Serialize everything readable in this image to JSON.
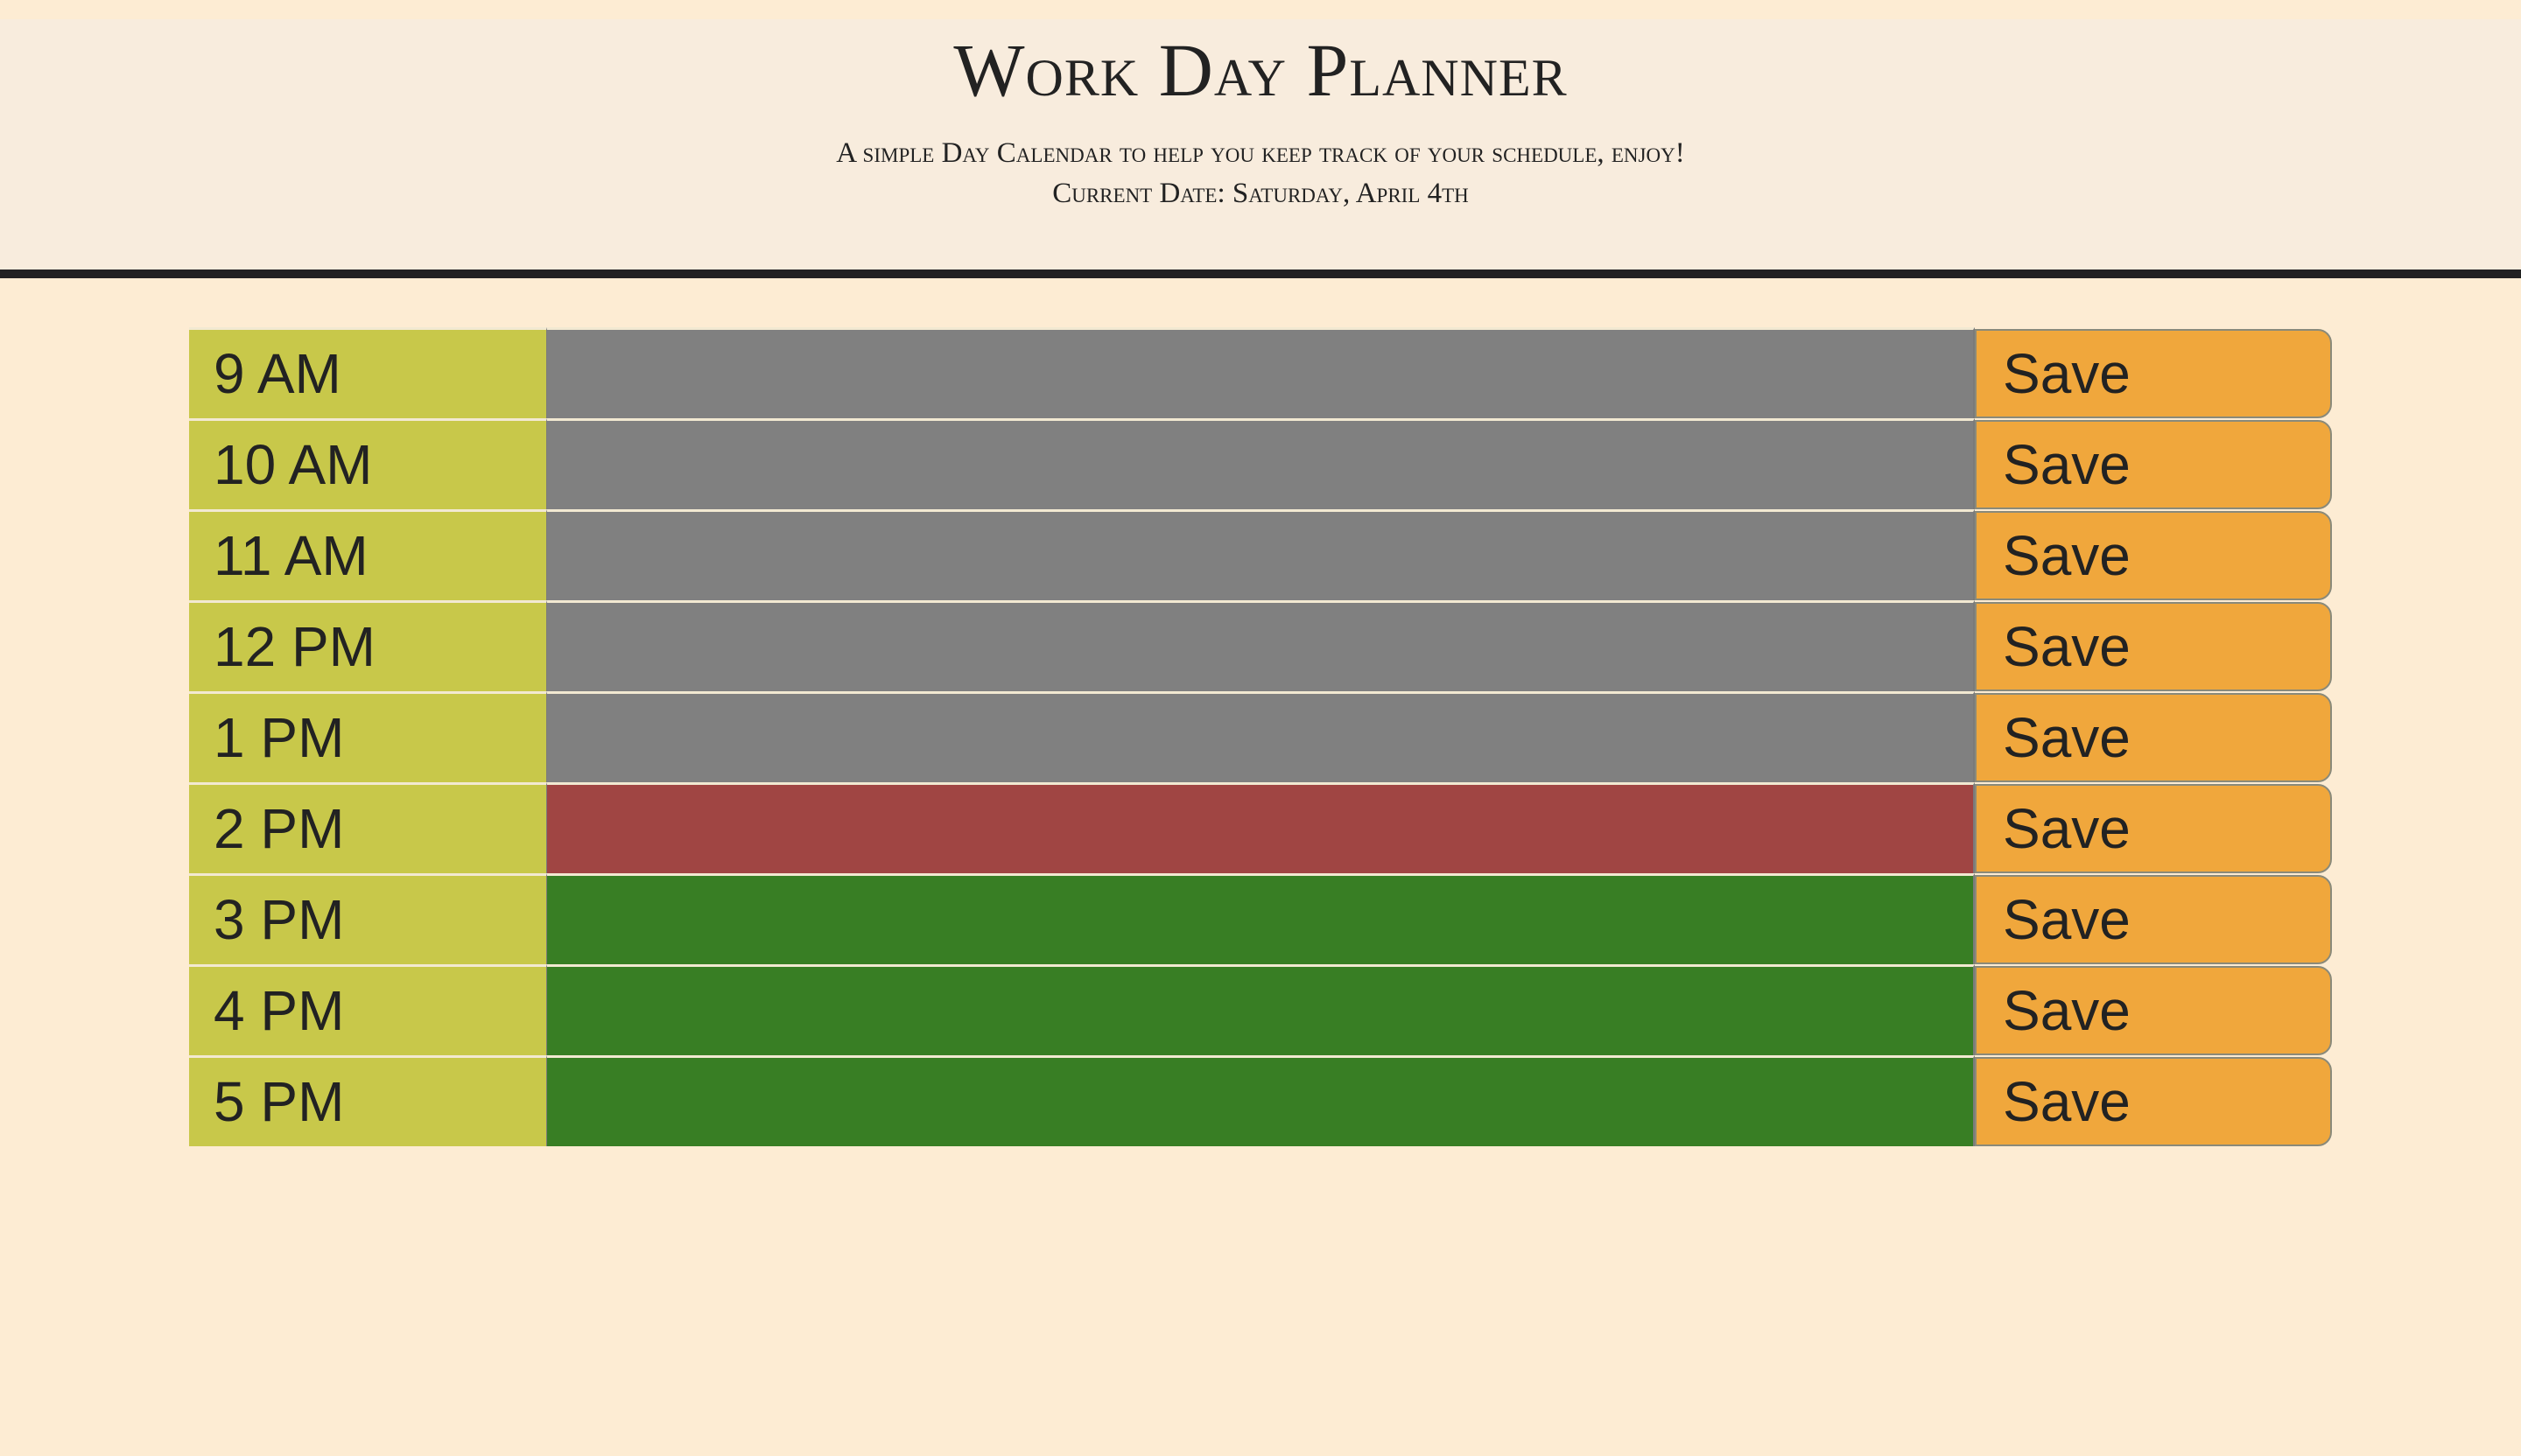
{
  "header": {
    "title": "Work Day Planner",
    "subtitle": "A simple Day Calendar to help you keep track of your schedule, enjoy!",
    "current_date_label": "Current Date: Saturday, April 4th"
  },
  "colors": {
    "past": "#808080",
    "present": "#a04543",
    "future": "#387e24",
    "hour": "#c8c84a",
    "save": "#f0a73c",
    "background": "#fdecd3"
  },
  "rows": [
    {
      "hour": "9 AM",
      "state": "past",
      "value": "",
      "save_label": "Save"
    },
    {
      "hour": "10 AM",
      "state": "past",
      "value": "",
      "save_label": "Save"
    },
    {
      "hour": "11 AM",
      "state": "past",
      "value": "",
      "save_label": "Save"
    },
    {
      "hour": "12 PM",
      "state": "past",
      "value": "",
      "save_label": "Save"
    },
    {
      "hour": "1 PM",
      "state": "past",
      "value": "",
      "save_label": "Save"
    },
    {
      "hour": "2 PM",
      "state": "present",
      "value": "",
      "save_label": "Save"
    },
    {
      "hour": "3 PM",
      "state": "future",
      "value": "",
      "save_label": "Save"
    },
    {
      "hour": "4 PM",
      "state": "future",
      "value": "",
      "save_label": "Save"
    },
    {
      "hour": "5 PM",
      "state": "future",
      "value": "",
      "save_label": "Save"
    }
  ]
}
